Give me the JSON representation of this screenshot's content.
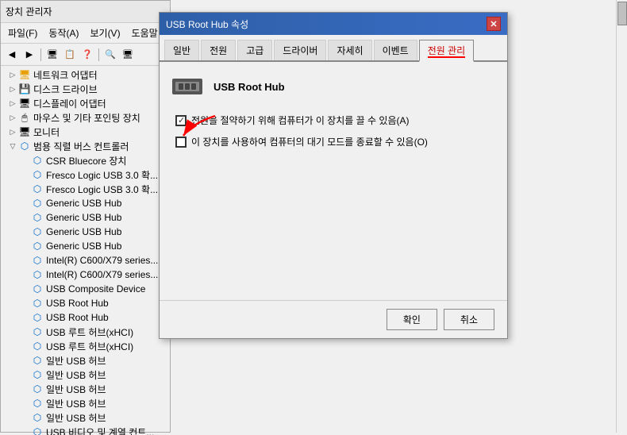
{
  "deviceManager": {
    "title": "장치 관리자",
    "menu": {
      "file": "파일(F)",
      "action": "동작(A)",
      "view": "보기(V)",
      "help": "도움말"
    },
    "treeItems": [
      {
        "label": "네트워크 어댑터",
        "level": 1,
        "hasChildren": true,
        "expanded": false
      },
      {
        "label": "디스크 드라이브",
        "level": 1,
        "hasChildren": true,
        "expanded": false
      },
      {
        "label": "디스플레이 어댑터",
        "level": 1,
        "hasChildren": true,
        "expanded": false
      },
      {
        "label": "마우스 및 기타 포인팅 장치",
        "level": 1,
        "hasChildren": true,
        "expanded": false
      },
      {
        "label": "모니터",
        "level": 1,
        "hasChildren": true,
        "expanded": false
      },
      {
        "label": "범용 직렬 버스 컨트롤러",
        "level": 1,
        "hasChildren": true,
        "expanded": true
      },
      {
        "label": "CSR Bluecore 장치",
        "level": 2,
        "hasChildren": false
      },
      {
        "label": "Fresco Logic USB 3.0 확...",
        "level": 2,
        "hasChildren": false
      },
      {
        "label": "Fresco Logic USB 3.0 확...",
        "level": 2,
        "hasChildren": false
      },
      {
        "label": "Generic USB Hub",
        "level": 2,
        "hasChildren": false
      },
      {
        "label": "Generic USB Hub",
        "level": 2,
        "hasChildren": false
      },
      {
        "label": "Generic USB Hub",
        "level": 2,
        "hasChildren": false
      },
      {
        "label": "Generic USB Hub",
        "level": 2,
        "hasChildren": false
      },
      {
        "label": "Intel(R) C600/X79 series...",
        "level": 2,
        "hasChildren": false
      },
      {
        "label": "Intel(R) C600/X79 series...",
        "level": 2,
        "hasChildren": false
      },
      {
        "label": "USB Composite Device",
        "level": 2,
        "hasChildren": false
      },
      {
        "label": "USB Root Hub",
        "level": 2,
        "hasChildren": false
      },
      {
        "label": "USB Root Hub",
        "level": 2,
        "hasChildren": false
      },
      {
        "label": "USB 루트 허브(xHCI)",
        "level": 2,
        "hasChildren": false
      },
      {
        "label": "USB 루트 허브(xHCI)",
        "level": 2,
        "hasChildren": false
      },
      {
        "label": "일반 USB 허브",
        "level": 2,
        "hasChildren": false
      },
      {
        "label": "일반 USB 허브",
        "level": 2,
        "hasChildren": false
      },
      {
        "label": "일반 USB 허브",
        "level": 2,
        "hasChildren": false
      },
      {
        "label": "일반 USB 허브",
        "level": 2,
        "hasChildren": false
      },
      {
        "label": "일반 USB 허브",
        "level": 2,
        "hasChildren": false
      },
      {
        "label": "USB 비디오 및 계열 컨트...",
        "level": 2,
        "hasChildren": false
      }
    ]
  },
  "dialog": {
    "title": "USB Root Hub 속성",
    "tabs": [
      {
        "label": "일반",
        "active": false
      },
      {
        "label": "전원",
        "active": false
      },
      {
        "label": "고급",
        "active": false
      },
      {
        "label": "드라이버",
        "active": false
      },
      {
        "label": "자세히",
        "active": false
      },
      {
        "label": "이벤트",
        "active": false
      },
      {
        "label": "전원 관리",
        "active": true
      }
    ],
    "deviceName": "USB Root Hub",
    "options": [
      {
        "label": "전원을 절약하기 위해 컴퓨터가 이 장치를 끌 수 있음(A)",
        "checked": false,
        "partialCheck": true
      },
      {
        "label": "이 장치를 사용하여 컴퓨터의 대기 모드를 종료할 수 있음(O)",
        "checked": false,
        "partialCheck": false
      }
    ],
    "buttons": {
      "ok": "확인",
      "cancel": "취소"
    }
  }
}
